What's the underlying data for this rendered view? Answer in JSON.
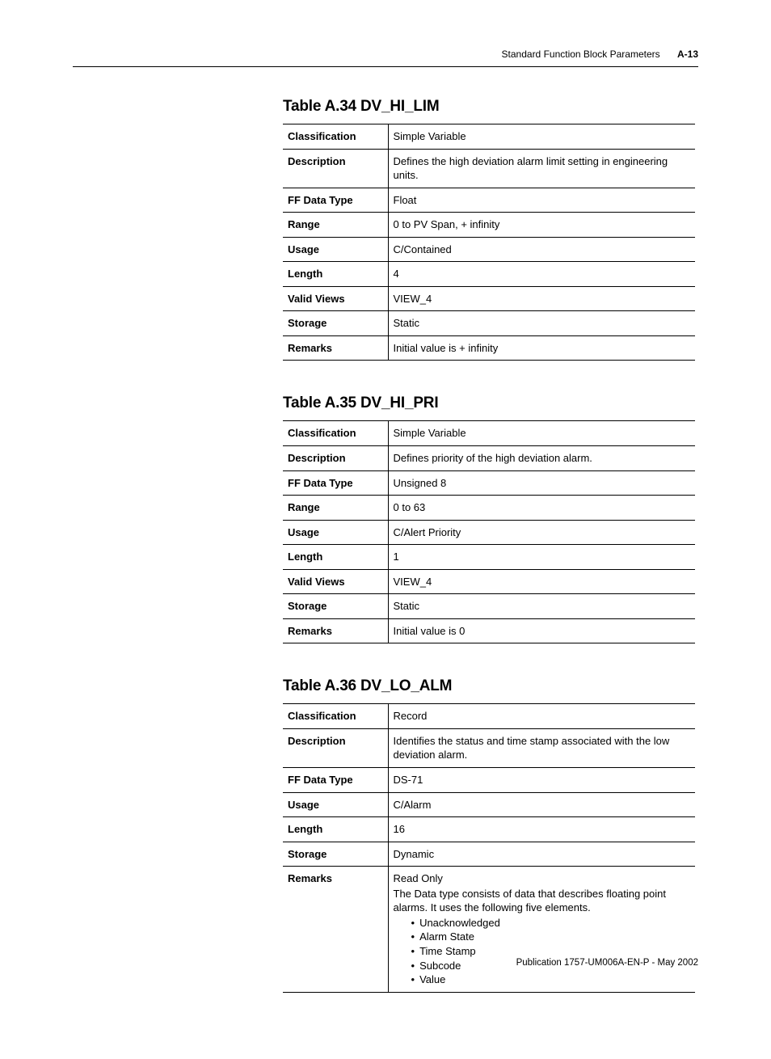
{
  "header": {
    "section": "Standard Function Block Parameters",
    "page_num": "A-13"
  },
  "tables": {
    "t1": {
      "title": "Table A.34 DV_HI_LIM",
      "rows": {
        "Classification": "Simple Variable",
        "Description": "Defines the high deviation alarm limit setting in engineering units.",
        "FF Data Type": "Float",
        "Range": "0 to PV Span, + infinity",
        "Usage": "C/Contained",
        "Length": "4",
        "Valid Views": "VIEW_4",
        "Storage": "Static",
        "Remarks": "Initial value is + infinity"
      }
    },
    "t2": {
      "title": "Table A.35 DV_HI_PRI",
      "rows": {
        "Classification": "Simple Variable",
        "Description": "Defines priority of the high deviation alarm.",
        "FF Data Type": "Unsigned 8",
        "Range": "0 to 63",
        "Usage": "C/Alert Priority",
        "Length": "1",
        "Valid Views": "VIEW_4",
        "Storage": "Static",
        "Remarks": "Initial value is 0"
      }
    },
    "t3": {
      "title": "Table A.36 DV_LO_ALM",
      "rows": {
        "Classification": "Record",
        "Description": "Identifies the status and time stamp associated with the low deviation alarm.",
        "FF Data Type": "DS-71",
        "Usage": "C/Alarm",
        "Length": "16",
        "Storage": "Dynamic"
      },
      "remarks": {
        "intro1": "Read Only",
        "intro2": "The Data type consists of data that describes floating point alarms. It uses the following five elements.",
        "items": [
          "Unacknowledged",
          "Alarm State",
          "Time Stamp",
          "Subcode",
          "Value"
        ]
      }
    }
  },
  "footer": "Publication 1757-UM006A-EN-P - May 2002"
}
